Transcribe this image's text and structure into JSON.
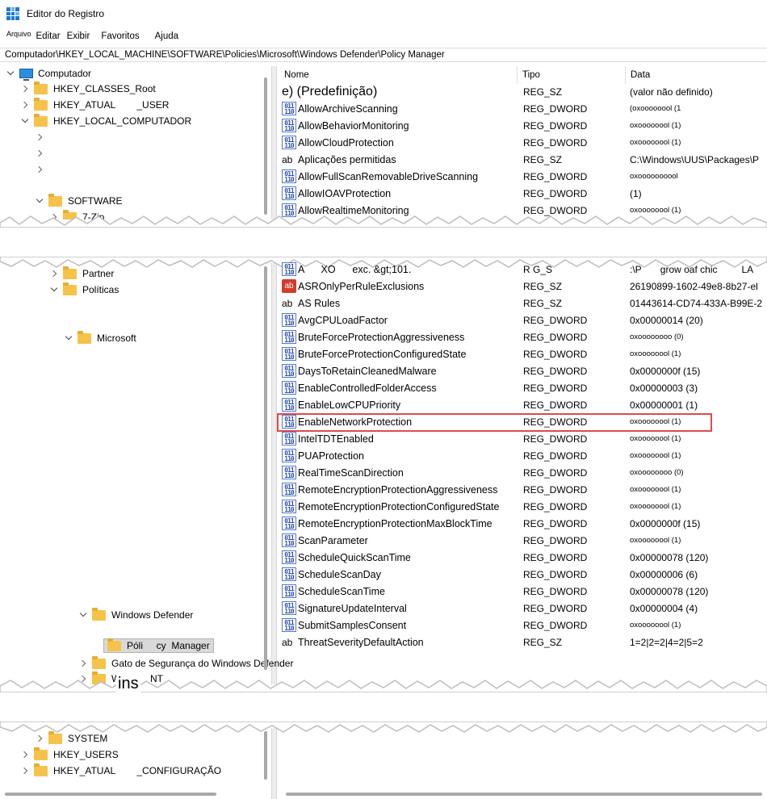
{
  "window": {
    "title": "Editor do Registro"
  },
  "menu": {
    "items": [
      "Arquivo",
      "Editar",
      "Exibir",
      "Favoritos",
      "Ajuda"
    ]
  },
  "address": {
    "path": "Computador\\HKEY_LOCAL_MACHINE\\SOFTWARE\\Policies\\Microsoft\\Windows Defender\\Policy Manager"
  },
  "columns": {
    "name": "Nome",
    "type": "Tipo",
    "data": "Data"
  },
  "tree": {
    "computer": "Computador",
    "classes_root": "HKEY_CLASSES_Root",
    "current_user": "HKEY_ATUAL        _USER",
    "local_machine": "HKEY_LOCAL_COMPUTADOR",
    "software": "SOFTWARE",
    "zip": "7-Zip",
    "partner": "Partner",
    "policies": "Políticas",
    "microsoft": "Microsoft",
    "windows_defender": "Windows Defender",
    "policy_manager": "Póli     cy  Manager",
    "security_center": "Gato de Segurança do Windows Defender",
    "wnt": "W           NT",
    "system": "SYSTEM",
    "users": "HKEY_USERS",
    "current_config": "HKEY_ATUAL        _CONFIGURAÇÃO"
  },
  "torn_text": "ins",
  "values_top": [
    {
      "name": "e) (Predefinição)",
      "type": "REG_SZ",
      "data": "(valor não definido)",
      "icon": "none"
    },
    {
      "name": "AllowArchiveScanning",
      "type": "REG_DWORD",
      "data": "(oxoooooool (1",
      "icon": "bin"
    },
    {
      "name": "AllowBehaviorMonitoring",
      "type": "REG_DWORD",
      "data": "oxoooooool (1)",
      "icon": "bin"
    },
    {
      "name": "AllowCloudProtection",
      "type": "REG_DWORD",
      "data": "oxoooooool (1)",
      "icon": "bin"
    },
    {
      "name": "Aplicações permitidas",
      "type": "REG_SZ",
      "data": "C:\\Windows\\UUS\\Packages\\P",
      "icon": "ab"
    },
    {
      "name": "AllowFullScanRemovableDriveScanning",
      "type": "REG_DWORD",
      "data": "oxoooooooool",
      "icon": "bin"
    },
    {
      "name": "AllowIOAVProtection",
      "type": "REG_DWORD",
      "data": "(1)",
      "icon": "bin"
    },
    {
      "name": "AllowRealtimeMonitoring",
      "type": "REG_DWORD",
      "data": "oxoooooool (1)",
      "icon": "bin"
    }
  ],
  "values_bottom": [
    {
      "name": "A      XO      exc. &gt;101.",
      "type": "R      G_S",
      "data": ":\\P       grow oaf chic         LA      ",
      "icon": "bin"
    },
    {
      "name": "ASROnlyPerRuleExclusions",
      "type": "REG_SZ",
      "data": "26190899-1602-49e8-8b27-el",
      "icon": "abred"
    },
    {
      "name": "AS Rules",
      "type": "REG_SZ",
      "data": "01443614-CD74-433A-B99E-2",
      "icon": "ab"
    },
    {
      "name": "AvgCPULoadFactor",
      "type": "REG_DWORD",
      "data": "0x00000014 (20)",
      "icon": "bin"
    },
    {
      "name": "BruteForceProtectionAggressiveness",
      "type": "REG_DWORD",
      "data": "oxoooooooo (0)",
      "icon": "bin"
    },
    {
      "name": "BruteForceProtectionConfiguredState",
      "type": "REG_DWORD",
      "data": "oxoooooool (1)",
      "icon": "bin"
    },
    {
      "name": "DaysToRetainCleanedMalware",
      "type": "REG_DWORD",
      "data": "0x0000000f (15)",
      "icon": "bin"
    },
    {
      "name": "EnableControlledFolderAccess",
      "type": "REG_DWORD",
      "data": "0x00000003 (3)",
      "icon": "bin"
    },
    {
      "name": "EnableLowCPUPriority",
      "type": "REG_DWORD",
      "data": "0x00000001 (1)",
      "icon": "bin"
    },
    {
      "name": "EnableNetworkProtection",
      "type": "REG_DWORD",
      "data": "oxoooooool (1)",
      "icon": "bin"
    },
    {
      "name": "IntelTDTEnabled",
      "type": "REG_DWORD",
      "data": "oxoooooool (1)",
      "icon": "bin"
    },
    {
      "name": "PUAProtection",
      "type": "REG_DWORD",
      "data": "oxoooooool (1)",
      "icon": "bin"
    },
    {
      "name": "RealTimeScanDirection",
      "type": "REG_DWORD",
      "data": "oxoooooooo (0)",
      "icon": "bin"
    },
    {
      "name": "RemoteEncryptionProtectionAggressiveness",
      "type": "REG_DWORD",
      "data": "oxoooooool (1)",
      "icon": "bin"
    },
    {
      "name": "RemoteEncryptionProtectionConfiguredState",
      "type": "REG_DWORD",
      "data": "oxoooooool (1)",
      "icon": "bin"
    },
    {
      "name": "RemoteEncryptionProtectionMaxBlockTime",
      "type": "REG_DWORD",
      "data": "0x0000000f (15)",
      "icon": "bin"
    },
    {
      "name": "ScanParameter",
      "type": "REG_DWORD",
      "data": "oxoooooool (1)",
      "icon": "bin"
    },
    {
      "name": "ScheduleQuickScanTime",
      "type": "REG_DWORD",
      "data": "0x00000078 (120)",
      "icon": "bin"
    },
    {
      "name": "ScheduleScanDay",
      "type": "REG_DWORD",
      "data": "0x00000006 (6)",
      "icon": "bin"
    },
    {
      "name": "ScheduleScanTime",
      "type": "REG_DWORD",
      "data": "0x00000078 (120)",
      "icon": "bin"
    },
    {
      "name": "SignatureUpdateInterval",
      "type": "REG_DWORD",
      "data": "0x00000004 (4)",
      "icon": "bin"
    },
    {
      "name": "SubmitSamplesConsent",
      "type": "REG_DWORD",
      "data": "oxoooooool (1)",
      "icon": "bin"
    },
    {
      "name": "ThreatSeverityDefaultAction",
      "type": "REG_SZ",
      "data": "1=2|2=2|4=2|5=2",
      "icon": "ab"
    }
  ]
}
